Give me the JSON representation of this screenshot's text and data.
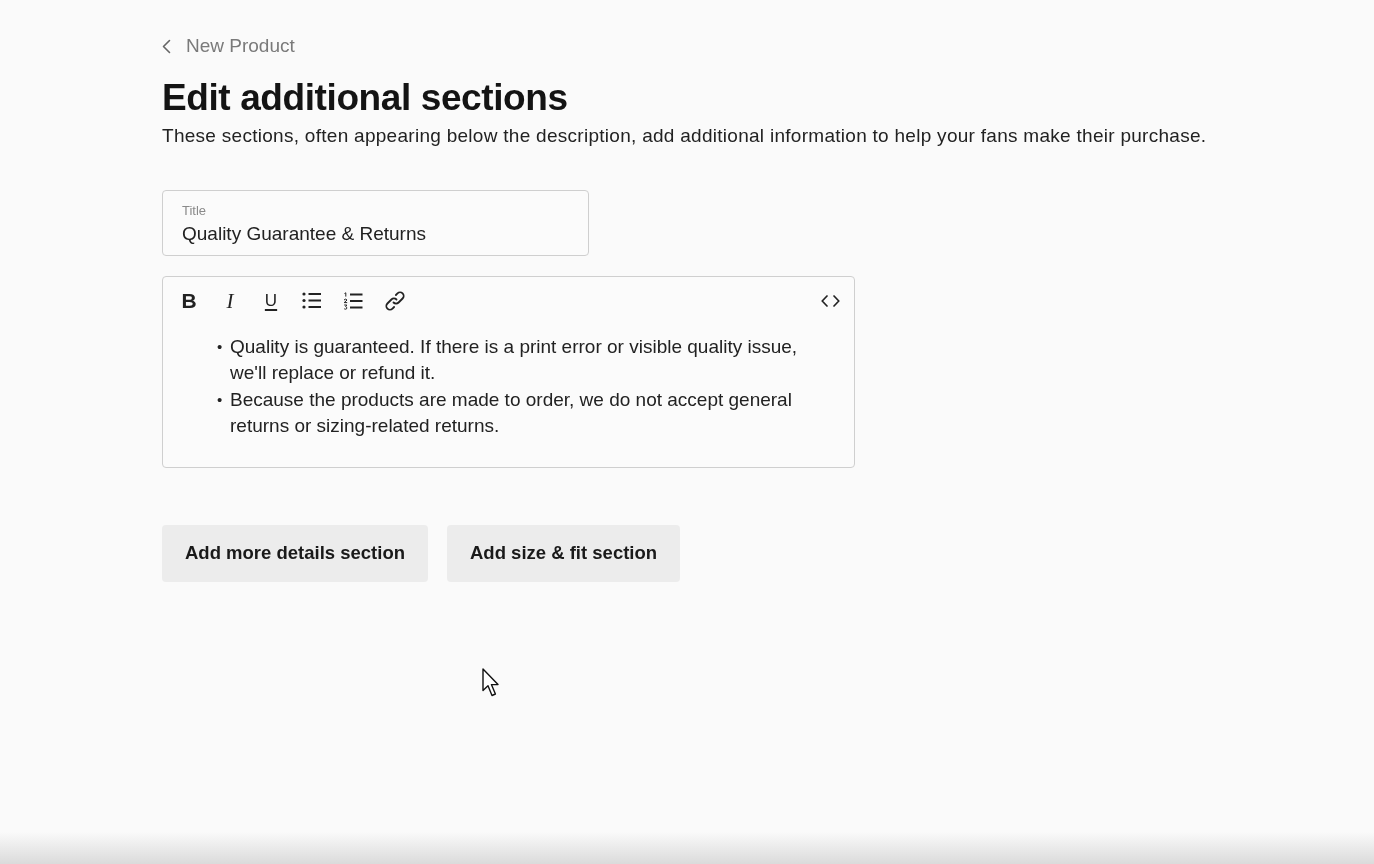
{
  "back_link": {
    "label": "New Product"
  },
  "heading": "Edit additional sections",
  "description": "These sections, often appearing below the description, add additional information to help your fans make their purchase.",
  "title_field": {
    "label": "Title",
    "value": "Quality Guarantee & Returns"
  },
  "editor": {
    "format_buttons": [
      {
        "kind": "bold",
        "glyph": "B"
      },
      {
        "kind": "italic",
        "glyph": "I"
      },
      {
        "kind": "underline",
        "glyph": "U"
      }
    ],
    "content": [
      {
        "marker": "•",
        "text": "Quality is guaranteed. If there is a print error or visible quality issue, we'll replace or refund it."
      },
      {
        "marker": "•",
        "text": "Because the products are made to order, we do not accept general returns or sizing-related returns."
      }
    ]
  },
  "buttons": [
    "Add more details section",
    "Add size & fit section"
  ]
}
